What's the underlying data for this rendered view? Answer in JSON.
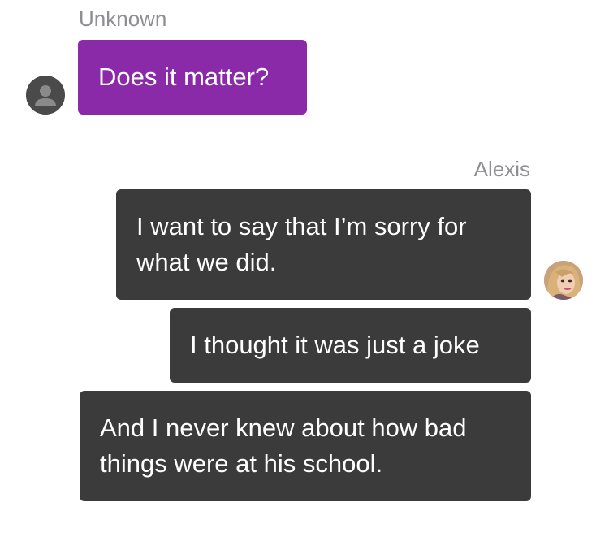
{
  "conversation": {
    "incoming_group": {
      "sender": "Unknown",
      "messages": [
        "Does it matter?"
      ]
    },
    "outgoing_group": {
      "sender": "Alexis",
      "messages": [
        "I want to say that I’m sorry for what we did.",
        "I thought it was just a joke",
        "And I never knew about how bad things were at his school."
      ]
    }
  },
  "colors": {
    "incoming_bubble": "#8a2aa8",
    "outgoing_bubble": "#3b3b3b",
    "sender_label": "#8e8e93",
    "bubble_text": "#ffffff"
  },
  "icons": {
    "unknown_avatar": "person-placeholder-icon",
    "alexis_avatar": "character-portrait"
  }
}
